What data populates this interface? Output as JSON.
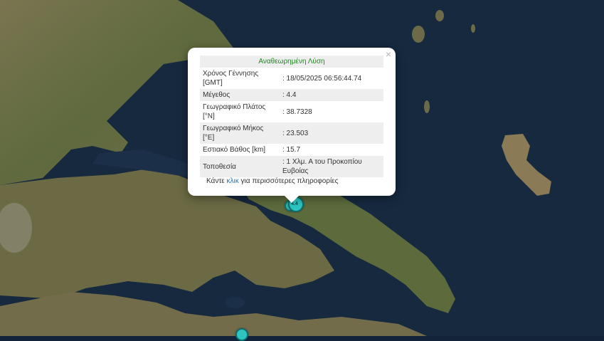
{
  "popup": {
    "title": "Αναθεωρημένη Λύση",
    "close_glyph": "×",
    "rows": [
      {
        "label": "Χρόνος Γέννησης [GMT]",
        "value": ": 18/05/2025 06:56:44.74"
      },
      {
        "label": "Μέγεθος",
        "value": ": 4.4"
      },
      {
        "label": "Γεωγραφικό Πλάτος [°N]",
        "value": ": 38.7328"
      },
      {
        "label": "Γεωγραφικό Μήκος [°E]",
        "value": ": 23.503"
      },
      {
        "label": "Εστιακό Βάθος [km]",
        "value": ": 15.7"
      },
      {
        "label": "Τοποθεσία",
        "value": ": 1 Χλμ. Α του Προκοπίου Ευβοίας"
      }
    ],
    "more_prefix": "Κάντε",
    "more_link": "κλικ",
    "more_suffix": "για περισσότερες πληροφορίες"
  },
  "map": {
    "land_color": "#6e6a45",
    "sea_color": "#172a44",
    "marker_color": "#2ec4c0",
    "marker_label": "4.4"
  }
}
